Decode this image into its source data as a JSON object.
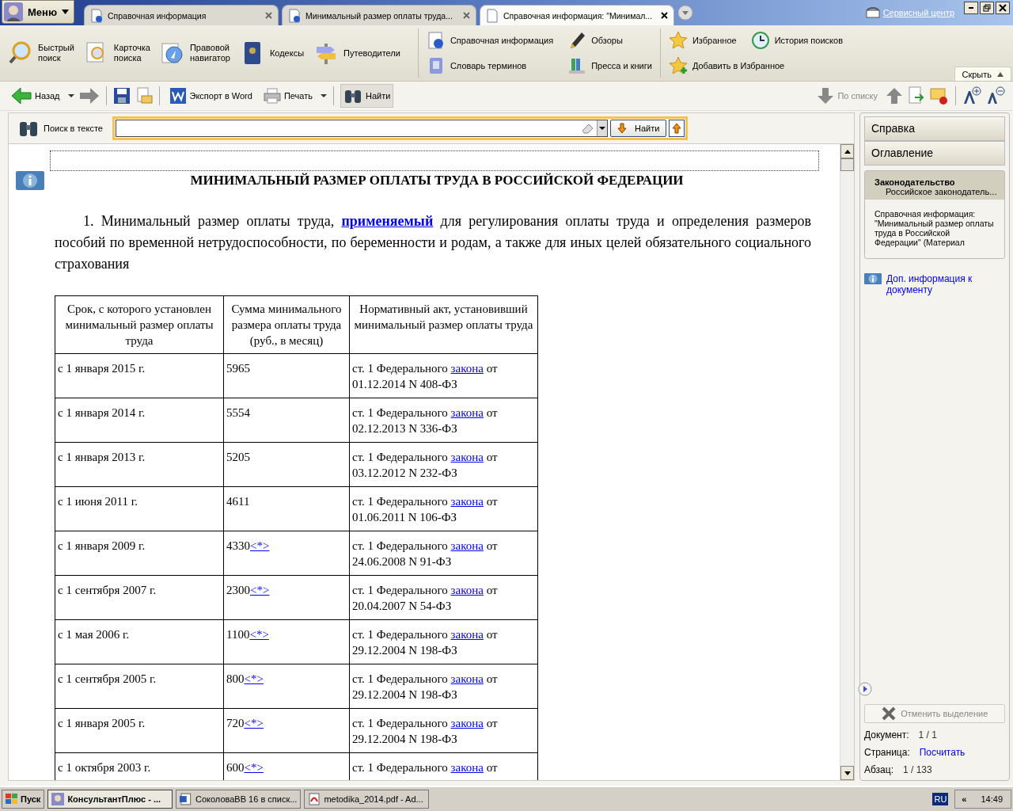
{
  "menu": {
    "label": "Меню"
  },
  "tabs": [
    {
      "label": "Справочная информация",
      "selected": false
    },
    {
      "label": "Минимальный размер оплаты труда...",
      "selected": false
    },
    {
      "label": "Справочная информация: \"Минимал...",
      "selected": true
    }
  ],
  "service_link": "Сервисный центр",
  "ribbon": {
    "large": [
      {
        "label": "Быстрый поиск"
      },
      {
        "label": "Карточка поиска"
      },
      {
        "label": "Правовой навигатор"
      },
      {
        "label": "Кодексы"
      },
      {
        "label": "Путеводители"
      }
    ],
    "small": [
      {
        "label": "Справочная информация"
      },
      {
        "label": "Обзоры"
      },
      {
        "label": "Словарь терминов"
      },
      {
        "label": "Пресса и книги"
      }
    ],
    "favorites": [
      {
        "label": "Избранное"
      },
      {
        "label": "История поисков"
      },
      {
        "label": "Добавить в Избранное"
      }
    ],
    "hide": "Скрыть"
  },
  "toolbar": {
    "back": "Назад",
    "export": "Экспорт в Word",
    "print": "Печать",
    "find": {
      "label": "Найти",
      "selected": true
    },
    "by_list": {
      "label": "По списку",
      "disabled": true
    }
  },
  "search": {
    "label": "Поиск в тексте",
    "button": "Найти"
  },
  "document": {
    "title": "МИНИМАЛЬНЫЙ РАЗМЕР ОПЛАТЫ ТРУДА В РОССИЙСКОЙ ФЕДЕРАЦИИ",
    "paragraph": {
      "before": "1. Минимальный размер оплаты труда,",
      "link": "применяемый",
      "after": "для регулирования оплаты труда и определения размеров пособий по временной нетрудоспособности, по беременности и родам, а также для иных целей обязательного социального страхования"
    },
    "table": {
      "columns": [
        "Срок, с которого установлен минимальный размер оплаты труда",
        "Сумма минимального размера оплаты труда (руб., в месяц)",
        "Нормативный акт, установивший минимальный размер оплаты труда"
      ],
      "rows": [
        {
          "date": "с 1 января 2015 г.",
          "amount": "5965",
          "act_before": "ст. 1 Федерального",
          "act_link": "закона",
          "act_after": "от 01.12.2014 N 408-ФЗ"
        },
        {
          "date": "с 1 января 2014 г.",
          "amount": "5554",
          "act_before": "ст. 1 Федерального",
          "act_link": "закона",
          "act_after": "от 02.12.2013 N 336-ФЗ"
        },
        {
          "date": "с 1 января 2013 г.",
          "amount": "5205",
          "act_before": "ст. 1 Федерального",
          "act_link": "закона",
          "act_after": "от 03.12.2012 N 232-ФЗ"
        },
        {
          "date": "с 1 июня 2011 г.",
          "amount": "4611",
          "act_before": "ст. 1 Федерального",
          "act_link": "закона",
          "act_after": "от 01.06.2011 N 106-ФЗ"
        },
        {
          "date": "с 1 января 2009 г.",
          "amount": "4330",
          "note": "<*>",
          "act_before": "ст. 1 Федерального",
          "act_link": "закона",
          "act_after": "от 24.06.2008 N 91-ФЗ"
        },
        {
          "date": "с 1 сентября 2007 г.",
          "amount": "2300",
          "note": "<*>",
          "act_before": "ст. 1 Федерального",
          "act_link": "закона",
          "act_after": "от 20.04.2007 N 54-ФЗ"
        },
        {
          "date": "с 1 мая 2006 г.",
          "amount": "1100",
          "note": "<*>",
          "act_before": "ст. 1 Федерального",
          "act_link": "закона",
          "act_after": "от 29.12.2004 N 198-ФЗ"
        },
        {
          "date": "с 1 сентября 2005 г.",
          "amount": "800",
          "note": "<*>",
          "act_before": "ст. 1 Федерального",
          "act_link": "закона",
          "act_after": "от 29.12.2004 N 198-ФЗ"
        },
        {
          "date": "с 1 января 2005 г.",
          "amount": "720",
          "note": "<*>",
          "act_before": "ст. 1 Федерального",
          "act_link": "закона",
          "act_after": "от 29.12.2004 N 198-ФЗ"
        },
        {
          "date": "с 1 октября 2003 г.",
          "amount": "600",
          "note": "<*>",
          "act_before": "ст. 1 Федерального",
          "act_link": "закона",
          "act_after": "от"
        }
      ]
    }
  },
  "side": {
    "tabs": [
      {
        "label": "Справка"
      },
      {
        "label": "Оглавление"
      }
    ],
    "info": {
      "heading": "Законодательство",
      "sub": "Российское законодатель...",
      "body": "Справочная информация: \"Минимальный размер оплаты труда в Российской Федерации\" (Материал"
    },
    "more_link": "Доп. информация к документу",
    "clear": {
      "label": "Отменить выделение",
      "disabled": true
    },
    "stats": [
      {
        "label": "Документ:",
        "value": "1 / 1",
        "kind": "text"
      },
      {
        "label": "Страница:",
        "value": "Посчитать",
        "kind": "link"
      },
      {
        "label": "Абзац:",
        "value": "1 / 133",
        "kind": "text"
      }
    ]
  },
  "taskbar": {
    "start": "Пуск",
    "tasks": [
      {
        "label": "КонсультантПлюс - ...",
        "selected": true
      },
      {
        "label": "СоколоваВВ 16 в списк...",
        "selected": false
      },
      {
        "label": "metodika_2014.pdf - Ad...",
        "selected": false
      }
    ],
    "lang": "RU",
    "chevron": "«",
    "clock": "14:49"
  }
}
